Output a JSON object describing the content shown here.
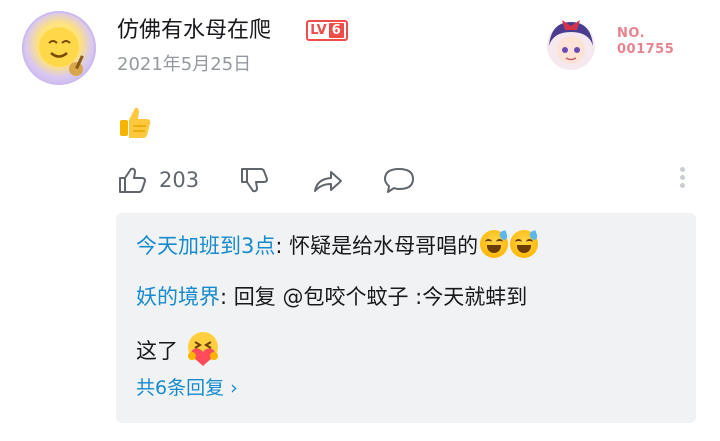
{
  "comment": {
    "username": "仿佛有水母在爬",
    "level_badge": {
      "prefix": "LV",
      "level": "6"
    },
    "date": "2021年5月25日",
    "fan_badge": {
      "line1": "NO.",
      "line2": "001755"
    },
    "content_emoji": "👍",
    "likes": "203"
  },
  "replies": [
    {
      "author": "今天加班到3点",
      "separator": ": ",
      "text": "怀疑是给水母哥唱的"
    },
    {
      "author": "妖的境界",
      "separator": ": ",
      "text_line1": "回复 @包咬个蚊子 :今天就蚌到",
      "text_line2": "这了"
    }
  ],
  "more_replies_label": "共6条回复 ›",
  "colors": {
    "accent_blue": "#178bcf",
    "level_red": "#f04c49",
    "fan_badge_pink": "#e8838e",
    "reply_bg": "#f1f2f3",
    "muted_gray": "#9499a0"
  },
  "icons": [
    "avatar",
    "fan-avatar",
    "thumbs-up-emoji",
    "like-icon",
    "dislike-icon",
    "share-icon",
    "comment-icon",
    "more-vertical-icon",
    "grinning-sweat-emoji",
    "hug-heart-emoji"
  ]
}
